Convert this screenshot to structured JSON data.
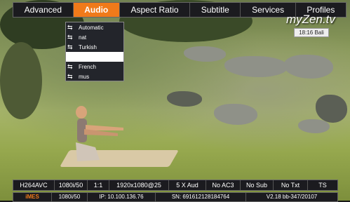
{
  "menu": {
    "tabs": [
      {
        "label": "Advanced"
      },
      {
        "label": "Audio"
      },
      {
        "label": "Aspect Ratio"
      },
      {
        "label": "Subtitle"
      },
      {
        "label": "Services"
      },
      {
        "label": "Profiles"
      }
    ],
    "active_index": 1,
    "active_color": "#f07a1a"
  },
  "brand": {
    "logo_text": "myZen.tv"
  },
  "clock": {
    "text": "18:16 Bali"
  },
  "audio_menu": {
    "items": [
      {
        "label": "Automatic",
        "icon": "plug-icon"
      },
      {
        "label": "nat",
        "icon": "plug-icon"
      },
      {
        "label": "Turkish",
        "icon": "plug-icon"
      },
      {
        "label": "",
        "icon": ""
      },
      {
        "label": "French",
        "icon": "plug-icon"
      },
      {
        "label": "mus",
        "icon": "plug-icon"
      }
    ],
    "selected_index": 3
  },
  "info_top": {
    "cells": [
      "H264AVC",
      "1080i/50",
      "1:1",
      "1920x1080@25",
      "5 X Aud",
      "No AC3",
      "No Sub",
      "No Txt",
      "TS"
    ]
  },
  "info_bottom": {
    "cells": [
      "iMES",
      "1080i/50",
      "IP: 10.100.136.76",
      "SN: 691612128184764",
      "V2.18 bb-347/20107"
    ]
  }
}
